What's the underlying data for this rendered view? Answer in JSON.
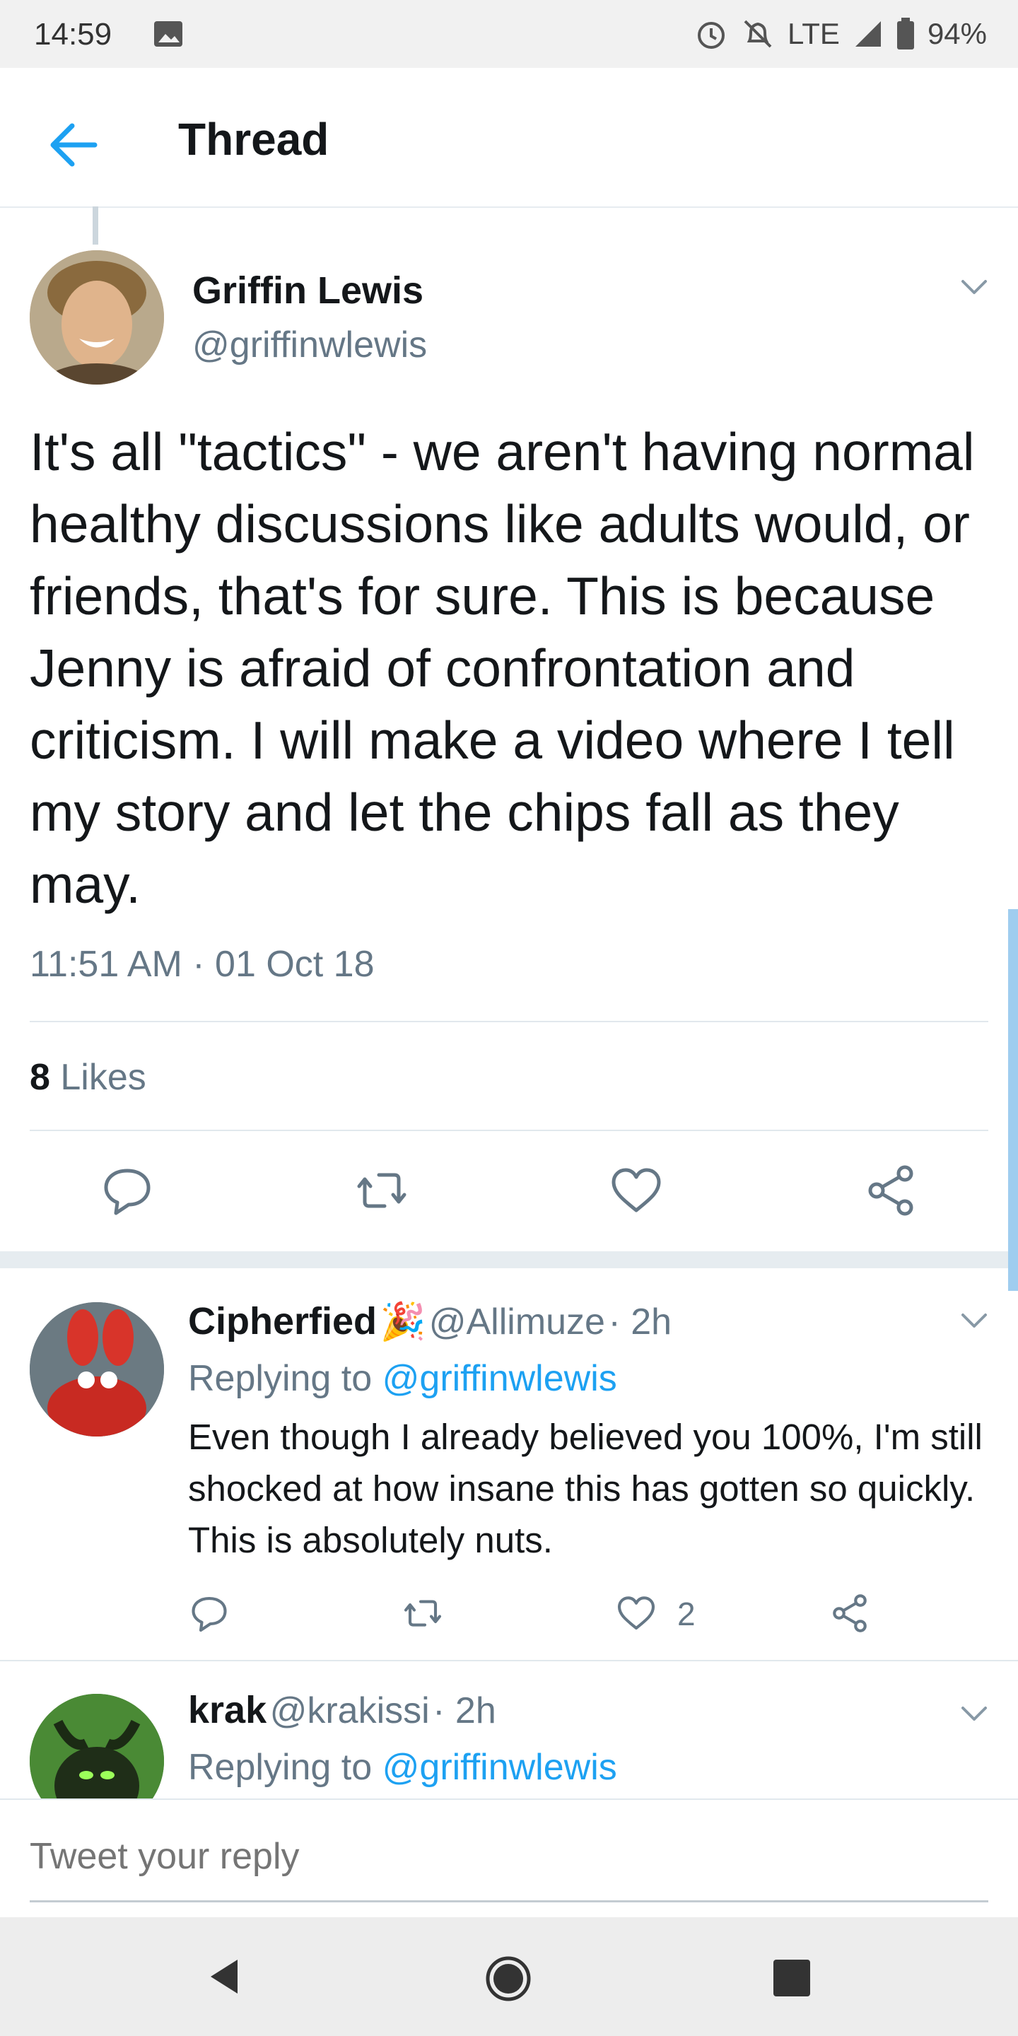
{
  "status_bar": {
    "time": "14:59",
    "network": "LTE",
    "battery": "94%"
  },
  "header": {
    "title": "Thread"
  },
  "tweet": {
    "name": "Griffin Lewis",
    "handle": "@griffinwlewis",
    "body": "It's all \"tactics\" - we aren't having normal healthy discussions like adults would, or friends, that's for sure. This is because Jenny is afraid of confrontation and criticism. I will make a video where I tell my story and let the chips fall as they may.",
    "timestamp": "11:51 AM · 01 Oct 18",
    "likes_count": "8",
    "likes_label": "Likes"
  },
  "replies": [
    {
      "name": "Cipherfied",
      "emoji": "🎉",
      "handle": "@Allimuze",
      "time": "· 2h",
      "replying_prefix": "Replying to",
      "replying_to": "@griffinwlewis",
      "body": "Even though I already believed you 100%, I'm still shocked at how insane this has gotten so quickly. This is absolutely nuts.",
      "like_count": "2"
    },
    {
      "name": "krak",
      "handle": "@krakissi",
      "time": "· 2h",
      "replying_prefix": "Replying to",
      "replying_to": "@griffinwlewis"
    }
  ],
  "reply_box": {
    "placeholder": "Tweet your reply"
  },
  "icons": [
    "back-arrow-icon",
    "chevron-down-icon",
    "reply-icon",
    "retweet-icon",
    "like-icon",
    "share-icon",
    "alarm-icon",
    "mute-icon",
    "signal-icon",
    "battery-icon",
    "image-icon"
  ],
  "colors": {
    "accent": "#1da1f2",
    "secondary_text": "#657786"
  }
}
